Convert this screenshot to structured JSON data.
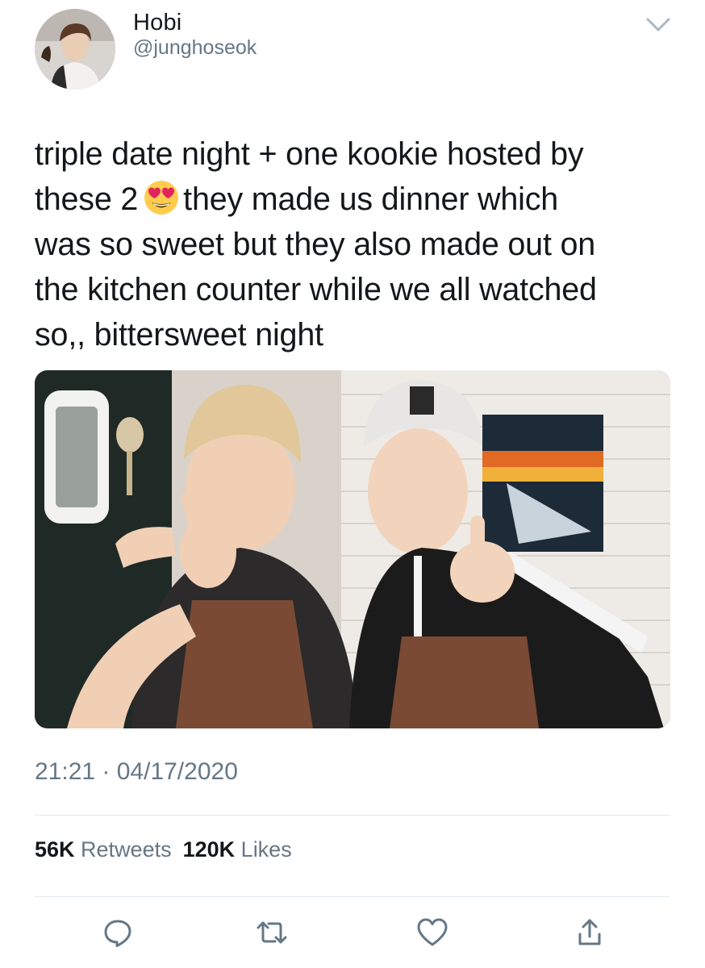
{
  "user": {
    "display_name": "Hobi",
    "handle": "@junghoseok",
    "avatar_icon": "profile-photo"
  },
  "tweet": {
    "lines": [
      "triple date night + one kookie hosted by",
      "these 2",
      "they made us dinner which",
      "was so sweet but they also made out on",
      "the kitchen counter while we all watched",
      "so,, bittersweet night"
    ],
    "emoji": "heart-eyes-emoji",
    "timestamp": "21:21 · 04/17/2020"
  },
  "stats": {
    "retweets_count": "56K",
    "retweets_label": "Retweets",
    "likes_count": "120K",
    "likes_label": "Likes"
  },
  "actions": {
    "reply_icon": "reply-icon",
    "retweet_icon": "retweet-icon",
    "like_icon": "heart-icon",
    "share_icon": "share-icon"
  },
  "colors": {
    "primary_text": "#14171a",
    "secondary_text": "#657786",
    "divider": "#e1e8ed"
  }
}
